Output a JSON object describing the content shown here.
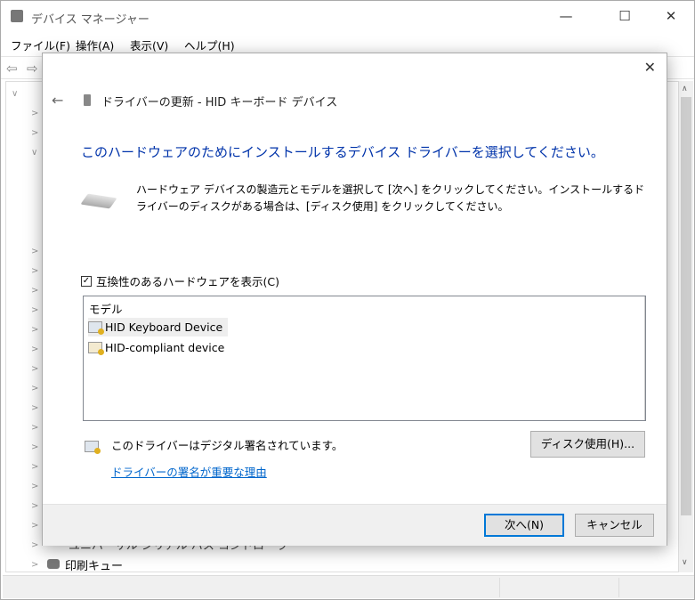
{
  "window": {
    "title": "デバイス マネージャー",
    "minimize": "—",
    "maximize": "☐",
    "close": "✕"
  },
  "menu": [
    "ファイル(F)",
    "操作(A)",
    "表示(V)",
    "ヘルプ(H)"
  ],
  "toolbar": {
    "back": "⇦",
    "forward": "⇨"
  },
  "tree": {
    "partial_label": "ユニバーサル シリアル バス コントローラー",
    "last_label": "印刷キュー"
  },
  "dialog": {
    "close": "✕",
    "back": "←",
    "title": "ドライバーの更新 - HID キーボード デバイス",
    "heading": "このハードウェアのためにインストールするデバイス ドライバーを選択してください。",
    "description": "ハードウェア デバイスの製造元とモデルを選択して [次へ] をクリックしてください。インストールするドライバーのディスクがある場合は、[ディスク使用] をクリックしてください。",
    "compat_checkbox": {
      "label": "互換性のあるハードウェアを表示(C)",
      "checked": true,
      "mark": "✓"
    },
    "model_header": "モデル",
    "models": [
      {
        "label": "HID Keyboard Device",
        "selected": true
      },
      {
        "label": "HID-compliant device",
        "selected": false
      }
    ],
    "signed_text": "このドライバーはデジタル署名されています。",
    "signing_link": "ドライバーの署名が重要な理由",
    "have_disk": "ディスク使用(H)...",
    "next": "次へ(N)",
    "cancel": "キャンセル"
  },
  "colors": {
    "heading": "#0033aa",
    "link": "#0066cc",
    "default_button_border": "#0078d7"
  }
}
